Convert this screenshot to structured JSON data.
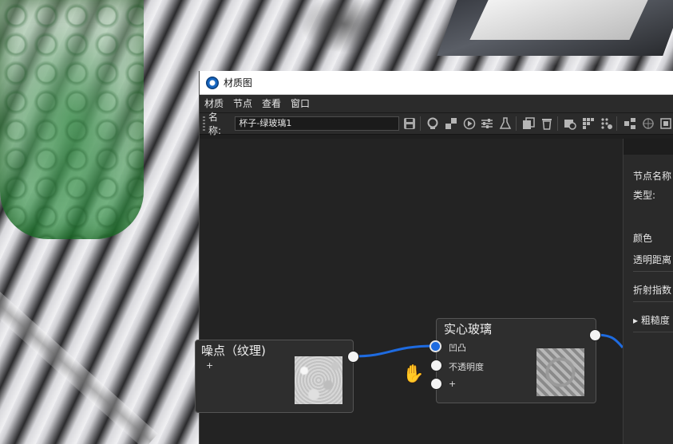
{
  "window": {
    "title": "材质图"
  },
  "menu": [
    "材质",
    "节点",
    "查看",
    "窗口"
  ],
  "toolbar": {
    "name_label": "名称:",
    "name_value": "杯子-绿玻璃1",
    "icons": [
      "save-icon",
      "sphere-preview-icon",
      "checker-icon",
      "play-circle-icon",
      "sliders-icon",
      "flask-icon",
      "duplicate-icon",
      "trash-icon",
      "camera-icon",
      "grid-plus-icon",
      "dots-plus-icon",
      "nodes-layout-icon",
      "crosshair-icon",
      "frame-icon"
    ]
  },
  "panel": {
    "node_name_label": "节点名称",
    "type_label": "类型:",
    "color_label": "颜色",
    "transmission_distance_label": "透明距离",
    "ior_label": "折射指数",
    "roughness_label": "▸ 粗糙度"
  },
  "nodes": {
    "noise": {
      "title": "噪点（纹理)",
      "add_port": "+"
    },
    "solid_glass": {
      "title": "实心玻璃",
      "ports": [
        "凹凸",
        "不透明度",
        "+"
      ]
    }
  },
  "colors": {
    "link_blue": "#1e6be0",
    "canvas_bg": "#232323",
    "node_bg": "#2e2e2e"
  }
}
